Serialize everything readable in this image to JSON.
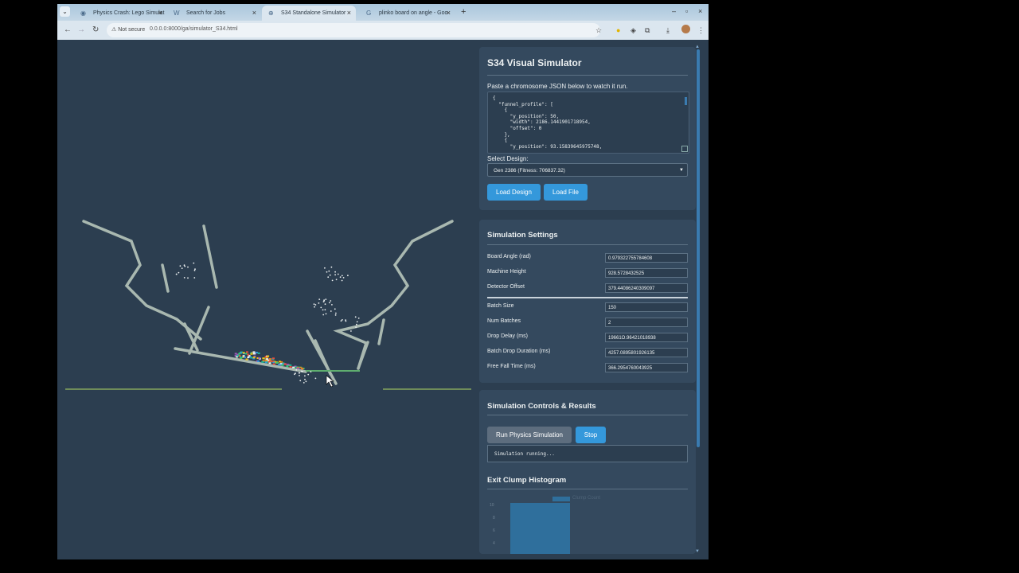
{
  "browser": {
    "tabs": [
      {
        "label": "Physics Crash: Lego Simulat",
        "favicon": "chrome-icon"
      },
      {
        "label": "Search for Jobs",
        "favicon": "w-icon"
      },
      {
        "label": "S34 Standalone Simulator",
        "favicon": "globe-icon",
        "active": true
      },
      {
        "label": "plinko board on angle - Goo",
        "favicon": "google-icon"
      }
    ],
    "security_label": "Not secure",
    "url": "0.0.0.0:8000/ga/simulator_S34.html"
  },
  "panel1": {
    "title": "S34 Visual Simulator",
    "instruction": "Paste a chromosome JSON below to watch it run.",
    "json_text": "{\n  \"funnel_profile\": [\n    {\n      \"y_position\": 50,\n      \"width\": 2186.1441901718954,\n      \"offset\": 0\n    },\n    {\n      \"y_position\": 93.15839645975748,",
    "select_label": "Select Design:",
    "select_value": "Gen 2386 (Fitness: 706837.32)",
    "load_design": "Load Design",
    "load_file": "Load File"
  },
  "settings": {
    "title": "Simulation Settings",
    "rows": [
      {
        "label": "Board Angle (rad)",
        "value": "0.979322755784608"
      },
      {
        "label": "Machine Height",
        "value": "928.5728432525"
      },
      {
        "label": "Detector Offset",
        "value": "379.44086240309097"
      },
      {
        "label": "Batch Size",
        "value": "150"
      },
      {
        "label": "Num Batches",
        "value": "2"
      },
      {
        "label": "Drop Delay (ms)",
        "value": "19661O.96421018938"
      },
      {
        "label": "Batch Drop Duration (ms)",
        "value": "4257.0895801926135"
      },
      {
        "label": "Free Fall Time (ms)",
        "value": "366.2954760043925"
      }
    ]
  },
  "controls": {
    "title": "Simulation Controls & Results",
    "run_label": "Run Physics Simulation",
    "stop_label": "Stop",
    "status": "Simulation running...",
    "histogram_title": "Exit Clump Histogram",
    "legend": "Clump Count",
    "y_ticks": [
      "10",
      "8",
      "6",
      "4"
    ]
  },
  "chart_data": {
    "type": "bar",
    "title": "Exit Clump Histogram",
    "series": [
      {
        "name": "Clump Count",
        "values": [
          10
        ]
      }
    ],
    "y_ticks": [
      10,
      8,
      6,
      4
    ]
  },
  "colors": {
    "page_bg": "#2c3e50",
    "panel_bg": "#34495e",
    "accent": "#3498db",
    "structure": "#a9b8b0",
    "ground": "#6f8c5a"
  }
}
